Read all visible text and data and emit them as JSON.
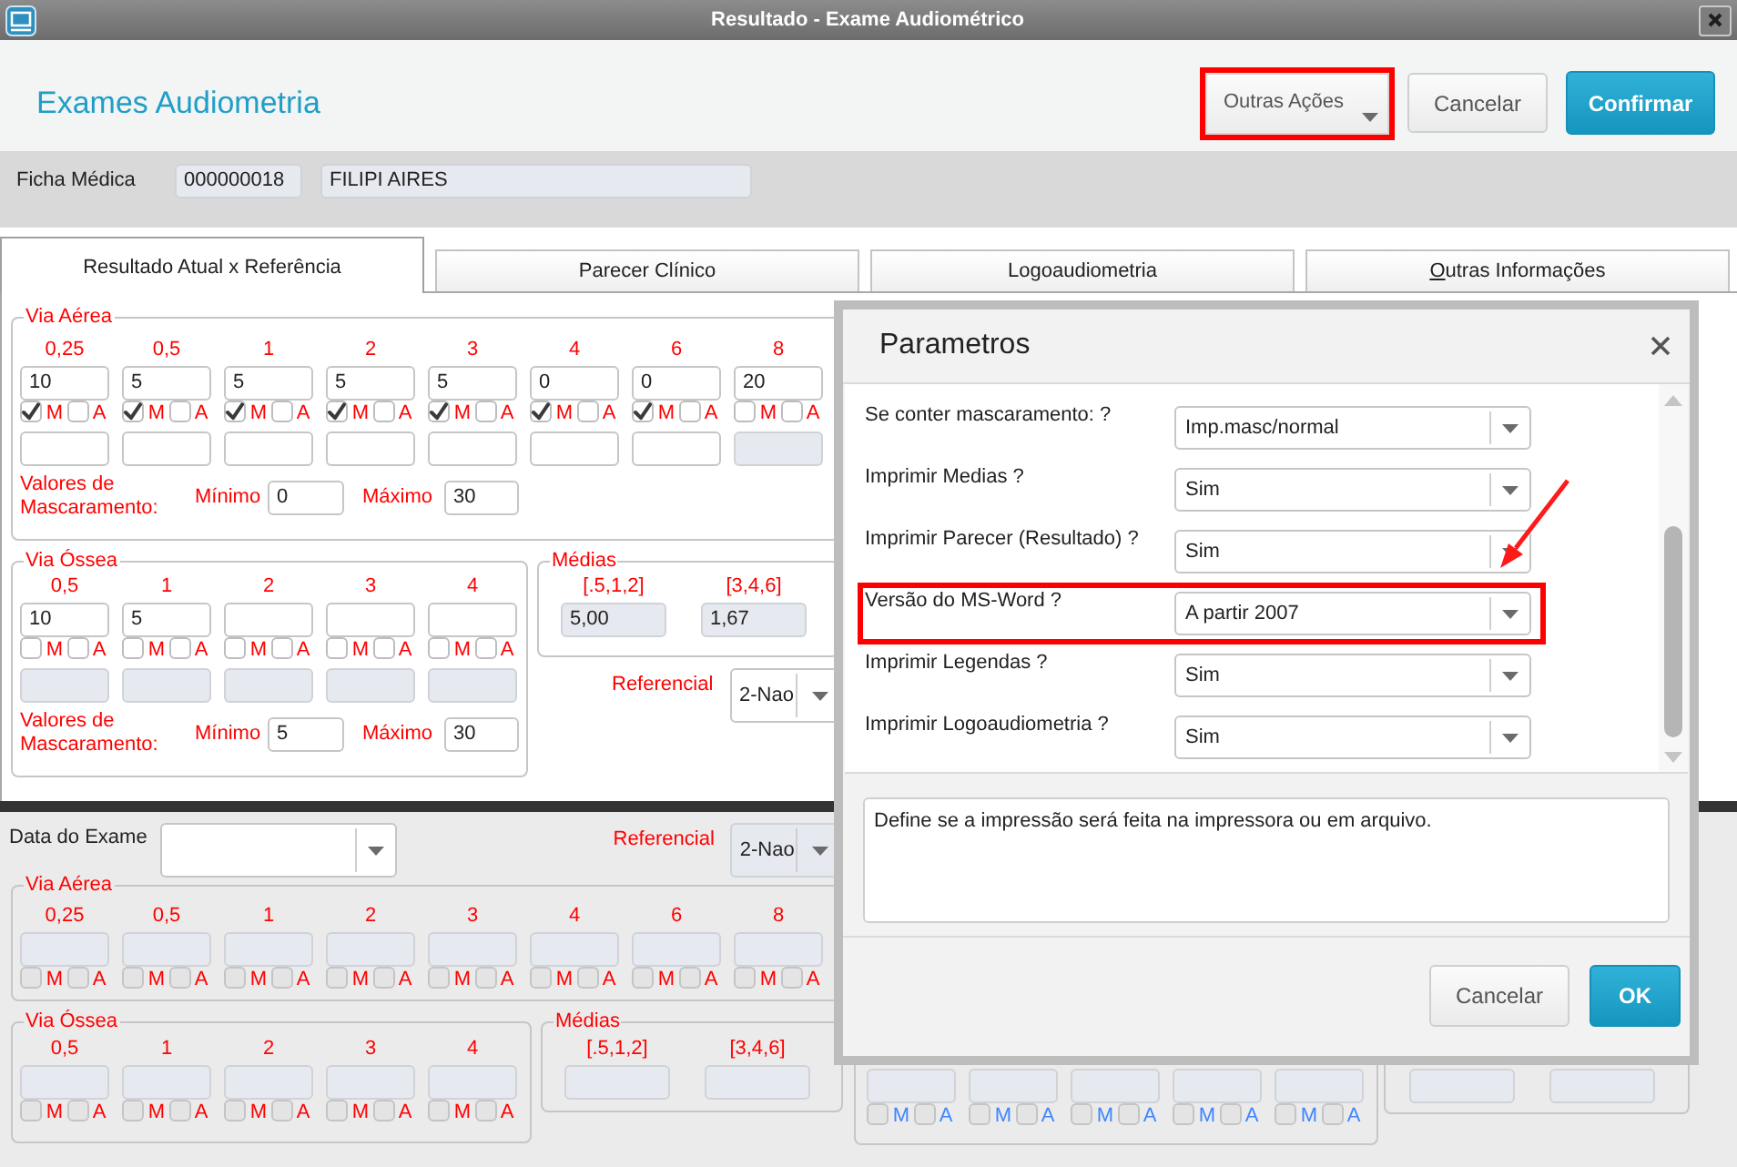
{
  "window": {
    "title": "Resultado - Exame Audiométrico"
  },
  "header": {
    "title": "Exames Audiometria",
    "buttons": [
      {
        "label": "Outras Ações",
        "kind": "menu",
        "highlighted": true
      },
      {
        "label": "Cancelar",
        "kind": "default",
        "highlighted": false
      },
      {
        "label": "Confirmar",
        "kind": "primary",
        "highlighted": false
      }
    ]
  },
  "patient": {
    "label": "Ficha Médica",
    "record": "000000018",
    "name": "FILIPI AIRES"
  },
  "tabs": [
    {
      "label": "Resultado Atual x Referência",
      "selected": true,
      "mnemonic": false
    },
    {
      "label": "Parecer Clínico",
      "selected": false,
      "mnemonic": false
    },
    {
      "label": "Logoaudiometria",
      "selected": false,
      "mnemonic": false
    },
    {
      "label": "Outras Informações",
      "selected": false,
      "mnemonic": true
    }
  ],
  "current": {
    "via_aerea": {
      "legend": "Via Aérea",
      "columns": [
        {
          "freq": "0,25",
          "value": "10",
          "value_disabled": false,
          "m_label": "M",
          "m_checked": true,
          "a_label": "A",
          "a_checked": false,
          "mask_disabled": false
        },
        {
          "freq": "0,5",
          "value": "5",
          "value_disabled": false,
          "m_label": "M",
          "m_checked": true,
          "a_label": "A",
          "a_checked": false,
          "mask_disabled": false
        },
        {
          "freq": "1",
          "value": "5",
          "value_disabled": false,
          "m_label": "M",
          "m_checked": true,
          "a_label": "A",
          "a_checked": false,
          "mask_disabled": false
        },
        {
          "freq": "2",
          "value": "5",
          "value_disabled": false,
          "m_label": "M",
          "m_checked": true,
          "a_label": "A",
          "a_checked": false,
          "mask_disabled": false
        },
        {
          "freq": "3",
          "value": "5",
          "value_disabled": false,
          "m_label": "M",
          "m_checked": true,
          "a_label": "A",
          "a_checked": false,
          "mask_disabled": false
        },
        {
          "freq": "4",
          "value": "0",
          "value_disabled": false,
          "m_label": "M",
          "m_checked": true,
          "a_label": "A",
          "a_checked": false,
          "mask_disabled": false
        },
        {
          "freq": "6",
          "value": "0",
          "value_disabled": false,
          "m_label": "M",
          "m_checked": true,
          "a_label": "A",
          "a_checked": false,
          "mask_disabled": false
        },
        {
          "freq": "8",
          "value": "20",
          "value_disabled": false,
          "m_label": "M",
          "m_checked": false,
          "a_label": "A",
          "a_checked": false,
          "mask_disabled": true
        }
      ],
      "masking": {
        "label": "Valores de Mascaramento:",
        "min_label": "Mínimo",
        "min": "0",
        "max_label": "Máximo",
        "max": "30"
      }
    },
    "via_ossea": {
      "legend": "Via Óssea",
      "columns": [
        {
          "freq": "0,5",
          "value": "10",
          "value_disabled": false,
          "m_label": "M",
          "m_checked": false,
          "a_label": "A",
          "a_checked": false,
          "mask_disabled": true
        },
        {
          "freq": "1",
          "value": "5",
          "value_disabled": false,
          "m_label": "M",
          "m_checked": false,
          "a_label": "A",
          "a_checked": false,
          "mask_disabled": true
        },
        {
          "freq": "2",
          "value_disabled": false,
          "m_label": "M",
          "m_checked": false,
          "a_label": "A",
          "a_checked": false,
          "mask_disabled": true
        },
        {
          "freq": "3",
          "value_disabled": false,
          "m_label": "M",
          "m_checked": false,
          "a_label": "A",
          "a_checked": false,
          "mask_disabled": true
        },
        {
          "freq": "4",
          "value_disabled": false,
          "m_label": "M",
          "m_checked": false,
          "a_label": "A",
          "a_checked": false,
          "mask_disabled": true
        }
      ],
      "masking": {
        "label": "Valores de Mascaramento:",
        "min_label": "Mínimo",
        "min": "5",
        "max_label": "Máximo",
        "max": "30"
      }
    },
    "medias": {
      "legend": "Médias",
      "items": [
        {
          "label": "[.5,1,2]",
          "value": "5,00",
          "disabled": true
        },
        {
          "label": "[3,4,6]",
          "value": "1,67",
          "disabled": true
        }
      ]
    },
    "referencial": {
      "label": "Referencial",
      "value": "2-Nao",
      "disabled": false
    }
  },
  "reference": {
    "date": {
      "label": "Data do Exame",
      "disabled": false
    },
    "referencial": {
      "label": "Referencial",
      "value": "2-Nao",
      "disabled": true
    },
    "sides": [
      {
        "kind": "full",
        "color": "#ff0000",
        "via_aerea": {
          "legend": "Via Aérea",
          "columns": [
            {
              "freq": "0,25",
              "value_disabled": true,
              "m_label": "M",
              "m_checked": false,
              "a_label": "A",
              "a_checked": false
            },
            {
              "freq": "0,5",
              "value_disabled": true,
              "m_label": "M",
              "m_checked": false,
              "a_label": "A",
              "a_checked": false
            },
            {
              "freq": "1",
              "value_disabled": true,
              "m_label": "M",
              "m_checked": false,
              "a_label": "A",
              "a_checked": false
            },
            {
              "freq": "2",
              "value_disabled": true,
              "m_label": "M",
              "m_checked": false,
              "a_label": "A",
              "a_checked": false
            },
            {
              "freq": "3",
              "value_disabled": true,
              "m_label": "M",
              "m_checked": false,
              "a_label": "A",
              "a_checked": false
            },
            {
              "freq": "4",
              "value_disabled": true,
              "m_label": "M",
              "m_checked": false,
              "a_label": "A",
              "a_checked": false
            },
            {
              "freq": "6",
              "value_disabled": true,
              "m_label": "M",
              "m_checked": false,
              "a_label": "A",
              "a_checked": false
            },
            {
              "freq": "8",
              "value_disabled": true,
              "m_label": "M",
              "m_checked": false,
              "a_label": "A",
              "a_checked": false
            }
          ]
        },
        "via_ossea": {
          "legend": "Via Óssea",
          "columns": [
            {
              "freq": "0,5",
              "value_disabled": true,
              "m_label": "M",
              "m_checked": false,
              "a_label": "A",
              "a_checked": false
            },
            {
              "freq": "1",
              "value_disabled": true,
              "m_label": "M",
              "m_checked": false,
              "a_label": "A",
              "a_checked": false
            },
            {
              "freq": "2",
              "value_disabled": true,
              "m_label": "M",
              "m_checked": false,
              "a_label": "A",
              "a_checked": false
            },
            {
              "freq": "3",
              "value_disabled": true,
              "m_label": "M",
              "m_checked": false,
              "a_label": "A",
              "a_checked": false
            },
            {
              "freq": "4",
              "value_disabled": true,
              "m_label": "M",
              "m_checked": false,
              "a_label": "A",
              "a_checked": false
            }
          ]
        },
        "medias": {
          "legend": "Médias",
          "items": [
            {
              "label": "[.5,1,2]",
              "disabled": true
            },
            {
              "label": "[3,4,6]",
              "disabled": true
            }
          ]
        }
      },
      {
        "kind": "clipped",
        "color": "#3f86ff",
        "via_ossea": {
          "columns": [
            {
              "value_disabled": true,
              "m_label": "M",
              "m_checked": false,
              "a_label": "A",
              "a_checked": false
            },
            {
              "value_disabled": true,
              "m_label": "M",
              "m_checked": false,
              "a_label": "A",
              "a_checked": false
            },
            {
              "value_disabled": true,
              "m_label": "M",
              "m_checked": false,
              "a_label": "A",
              "a_checked": false
            },
            {
              "value_disabled": true,
              "m_label": "M",
              "m_checked": false,
              "a_label": "A",
              "a_checked": false
            },
            {
              "value_disabled": true,
              "m_label": "M",
              "m_checked": false,
              "a_label": "A",
              "a_checked": false
            }
          ]
        },
        "medias": {
          "items": [
            {
              "disabled": true
            },
            {
              "disabled": true
            }
          ]
        }
      }
    ]
  },
  "dialog": {
    "title": "Parametros",
    "params": [
      {
        "label": "Se conter mascaramento: ?",
        "value": "Imp.masc/normal",
        "highlighted": false
      },
      {
        "label": "Imprimir Medias ?",
        "value": "Sim",
        "highlighted": false
      },
      {
        "label": "Imprimir Parecer (Resultado) ?",
        "value": "Sim",
        "highlighted": false
      },
      {
        "label": "Versão do MS-Word ?",
        "value": "A partir 2007",
        "highlighted": true
      },
      {
        "label": "Imprimir Legendas ?",
        "value": "Sim",
        "highlighted": false
      },
      {
        "label": "Imprimir Logoaudiometria ?",
        "value": "Sim",
        "highlighted": false
      }
    ],
    "help": "Define se a impressão será feita na impressora ou em arquivo.",
    "buttons": [
      {
        "label": "Cancelar",
        "kind": "default"
      },
      {
        "label": "OK",
        "kind": "primary"
      }
    ]
  }
}
